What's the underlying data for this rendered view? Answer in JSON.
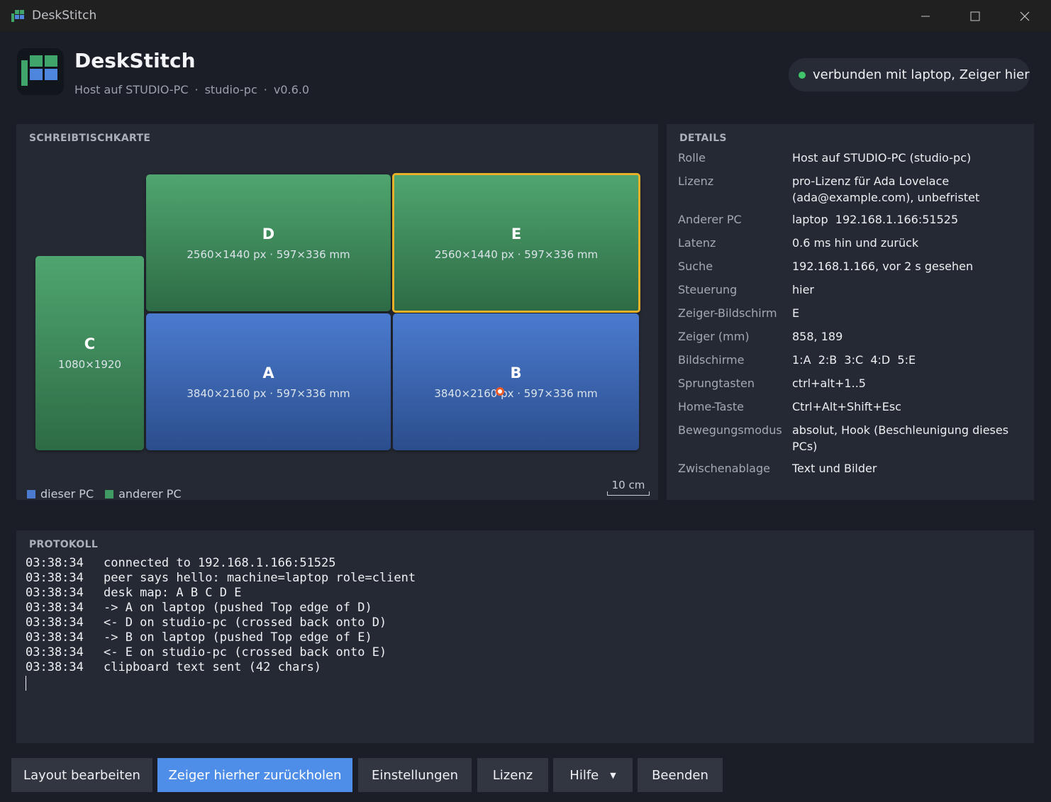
{
  "titlebar": {
    "title": "DeskStitch",
    "minimize_icon": "minimize-icon",
    "maximize_icon": "maximize-icon",
    "close_icon": "close-icon"
  },
  "header": {
    "app_name": "DeskStitch",
    "host_role": "Host auf STUDIO-PC",
    "machine": "studio-pc",
    "version": "v0.6.0",
    "separator": "·",
    "logo_icon": "grid-logo-icon"
  },
  "status": {
    "text": "verbunden mit laptop, Zeiger hier",
    "color": "#3fc46a"
  },
  "map": {
    "title": "SCHREIBTISCHKARTE",
    "screens": [
      {
        "id": "D",
        "dims": "2560×1440 px · 597×336 mm",
        "owner": "other"
      },
      {
        "id": "E",
        "dims": "2560×1440 px · 597×336 mm",
        "owner": "other",
        "selected": true
      },
      {
        "id": "C",
        "dims": "1080×1920",
        "owner": "other"
      },
      {
        "id": "A",
        "dims": "3840×2160 px · 597×336 mm",
        "owner": "this"
      },
      {
        "id": "B",
        "dims": "3840×2160 px · 597×336 mm",
        "owner": "this"
      }
    ],
    "legend": {
      "this_pc": "dieser PC",
      "other_pc": "anderer PC"
    },
    "scale_label": "10 cm",
    "colors": {
      "this_pc": "#4b7bcf",
      "other_pc": "#3f9a63",
      "selected": "#e8b12a",
      "cursor": "#ea5a2a"
    }
  },
  "details": {
    "title": "DETAILS",
    "rows": [
      {
        "label": "Rolle",
        "value": "Host auf STUDIO-PC (studio-pc)"
      },
      {
        "label": "Lizenz",
        "value": "pro-Lizenz für Ada Lovelace (ada@example.com), unbefristet"
      },
      {
        "label": "Anderer PC",
        "value": "laptop  192.168.1.166:51525"
      },
      {
        "label": "Latenz",
        "value": "0.6 ms hin und zurück"
      },
      {
        "label": "Suche",
        "value": "192.168.1.166, vor 2 s gesehen"
      },
      {
        "label": "Steuerung",
        "value": "hier"
      },
      {
        "label": "Zeiger-Bildschirm",
        "value": "E"
      },
      {
        "label": "Zeiger (mm)",
        "value": "858, 189"
      },
      {
        "label": "Bildschirme",
        "value": "1:A  2:B  3:C  4:D  5:E"
      },
      {
        "label": "Sprungtasten",
        "value": "ctrl+alt+1..5"
      },
      {
        "label": "Home-Taste",
        "value": "Ctrl+Alt+Shift+Esc"
      },
      {
        "label": "Bewegungsmodus",
        "value": "absolut, Hook (Beschleunigung dieses PCs)"
      },
      {
        "label": "Zwischenablage",
        "value": "Text und Bilder"
      }
    ]
  },
  "log": {
    "title": "PROTOKOLL",
    "lines": [
      {
        "time": "03:38:34",
        "text": "connected to 192.168.1.166:51525"
      },
      {
        "time": "03:38:34",
        "text": "peer says hello: machine=laptop role=client"
      },
      {
        "time": "03:38:34",
        "text": "desk map: A B C D E"
      },
      {
        "time": "03:38:34",
        "text": "-> A on laptop (pushed Top edge of D)"
      },
      {
        "time": "03:38:34",
        "text": "<- D on studio-pc (crossed back onto D)"
      },
      {
        "time": "03:38:34",
        "text": "-> B on laptop (pushed Top edge of E)"
      },
      {
        "time": "03:38:34",
        "text": "<- E on studio-pc (crossed back onto E)"
      },
      {
        "time": "03:38:34",
        "text": "clipboard text sent (42 chars)"
      }
    ]
  },
  "buttons": {
    "edit_layout": "Layout bearbeiten",
    "recall_pointer": "Zeiger hierher zurückholen",
    "settings": "Einstellungen",
    "license": "Lizenz",
    "help": "Hilfe",
    "help_caret": "▼",
    "quit": "Beenden"
  }
}
